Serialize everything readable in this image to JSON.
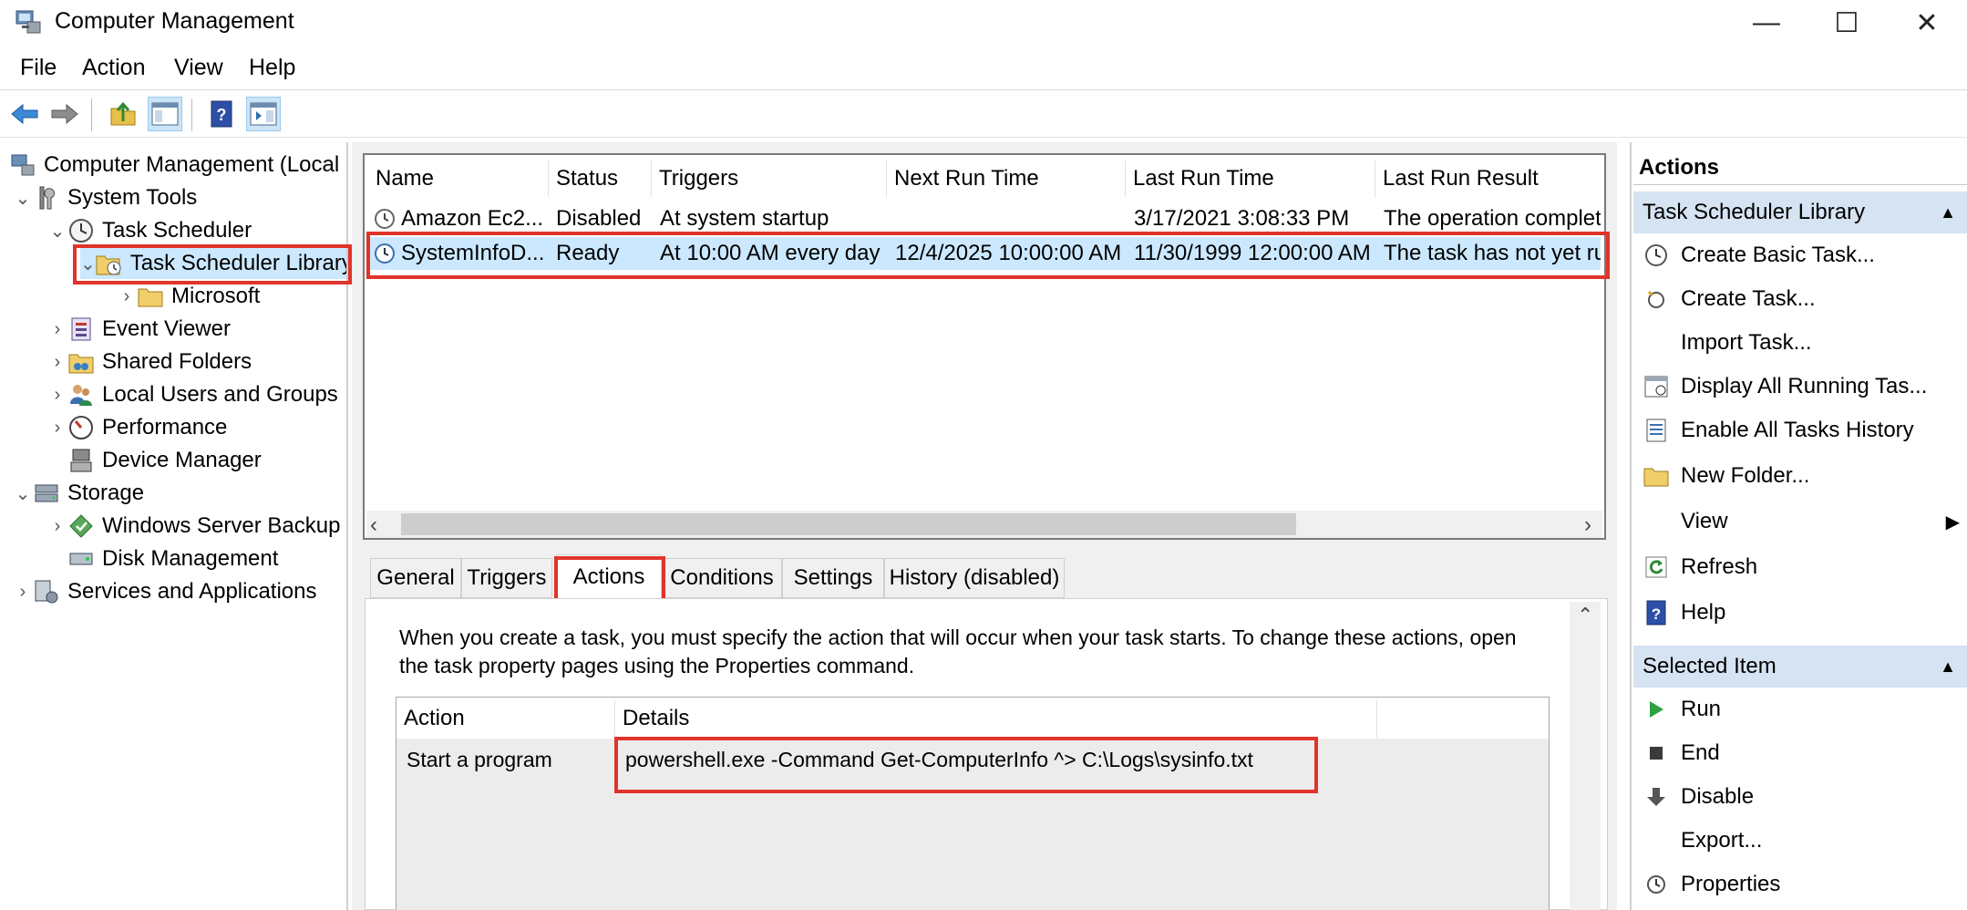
{
  "window": {
    "title": "Computer Management",
    "minimize": "—",
    "maximize": "☐",
    "close": "✕"
  },
  "menu": [
    "File",
    "Action",
    "View",
    "Help"
  ],
  "tree": {
    "root": "Computer Management (Local",
    "system_tools": "System Tools",
    "task_scheduler": "Task Scheduler",
    "task_scheduler_library": "Task Scheduler Library",
    "microsoft": "Microsoft",
    "event_viewer": "Event Viewer",
    "shared_folders": "Shared Folders",
    "local_users": "Local Users and Groups",
    "performance": "Performance",
    "device_manager": "Device Manager",
    "storage": "Storage",
    "wsb": "Windows Server Backup",
    "disk_management": "Disk Management",
    "services": "Services and Applications"
  },
  "tasks": {
    "columns": [
      "Name",
      "Status",
      "Triggers",
      "Next Run Time",
      "Last Run Time",
      "Last Run Result"
    ],
    "rows": [
      {
        "name": "Amazon Ec2...",
        "status": "Disabled",
        "triggers": "At system startup",
        "next": "",
        "last": "3/17/2021 3:08:33 PM",
        "result": "The operation completed"
      },
      {
        "name": "SystemInfoD...",
        "status": "Ready",
        "triggers": "At 10:00 AM every day",
        "next": "12/4/2025 10:00:00 AM",
        "last": "11/30/1999 12:00:00 AM",
        "result": "The task has not yet run"
      }
    ]
  },
  "tabs": [
    "General",
    "Triggers",
    "Actions",
    "Conditions",
    "Settings",
    "History (disabled)"
  ],
  "active_tab": "Actions",
  "actions_tab": {
    "description": "When you create a task, you must specify the action that will occur when your task starts.  To change these actions, open the task property pages using the Properties command.",
    "columns": [
      "Action",
      "Details"
    ],
    "rows": [
      {
        "action": "Start a program",
        "details": "powershell.exe -Command Get-ComputerInfo ^> C:\\Logs\\sysinfo.txt"
      }
    ]
  },
  "actions_pane": {
    "header": "Actions",
    "section1": "Task Scheduler Library",
    "items1": [
      "Create Basic Task...",
      "Create Task...",
      "Import Task...",
      "Display All Running Tas...",
      "Enable All Tasks History",
      "New Folder...",
      "View",
      "Refresh",
      "Help"
    ],
    "section2": "Selected Item",
    "items2": [
      "Run",
      "End",
      "Disable",
      "Export...",
      "Properties"
    ]
  },
  "colors": {
    "highlight": "#e0342b",
    "section_bg": "#d5e3f2",
    "selected_row": "#cce8ff"
  }
}
